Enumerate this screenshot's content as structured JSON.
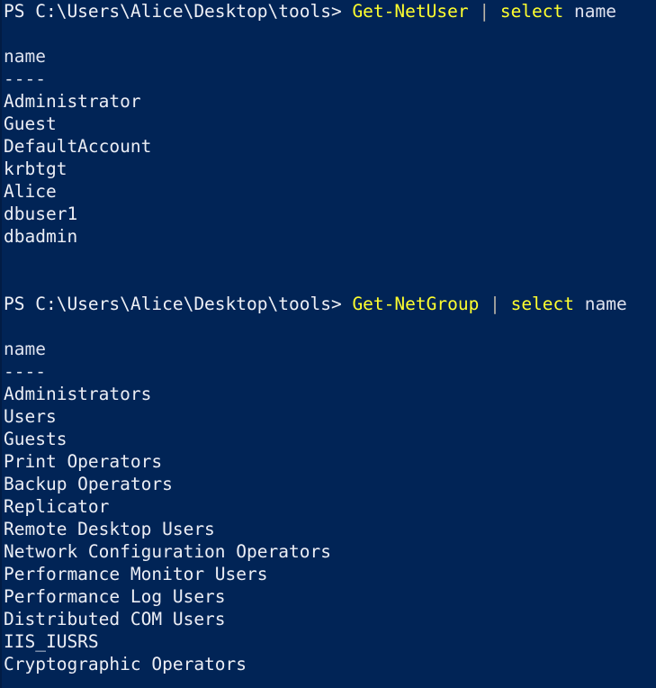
{
  "terminal": {
    "shell_name": "Windows PowerShell",
    "background_color": "#012456",
    "foreground_color": "#e6e8ef",
    "command_color": "#ffff2e",
    "pipe_color": "#b9b4a8",
    "prompt_text": "PS C:\\Users\\Alice\\Desktop\\tools>",
    "pipe_symbol": "|",
    "blank": ""
  },
  "blocks": [
    {
      "id": "get-netuser-block",
      "prompt": "PS C:\\Users\\Alice\\Desktop\\tools>",
      "command": "Get-NetUser",
      "pipe": "|",
      "select_keyword": "select",
      "select_property": "name",
      "header": "name",
      "rule": "----",
      "rows": [
        "Administrator",
        "Guest",
        "DefaultAccount",
        "krbtgt",
        "Alice",
        "dbuser1",
        "dbadmin"
      ]
    },
    {
      "id": "get-netgroup-block",
      "prompt": "PS C:\\Users\\Alice\\Desktop\\tools>",
      "command": "Get-NetGroup",
      "pipe": "|",
      "select_keyword": "select",
      "select_property": "name",
      "header": "name",
      "rule": "----",
      "rows": [
        "Administrators",
        "Users",
        "Guests",
        "Print Operators",
        "Backup Operators",
        "Replicator",
        "Remote Desktop Users",
        "Network Configuration Operators",
        "Performance Monitor Users",
        "Performance Log Users",
        "Distributed COM Users",
        "IIS_IUSRS",
        "Cryptographic Operators"
      ]
    }
  ]
}
